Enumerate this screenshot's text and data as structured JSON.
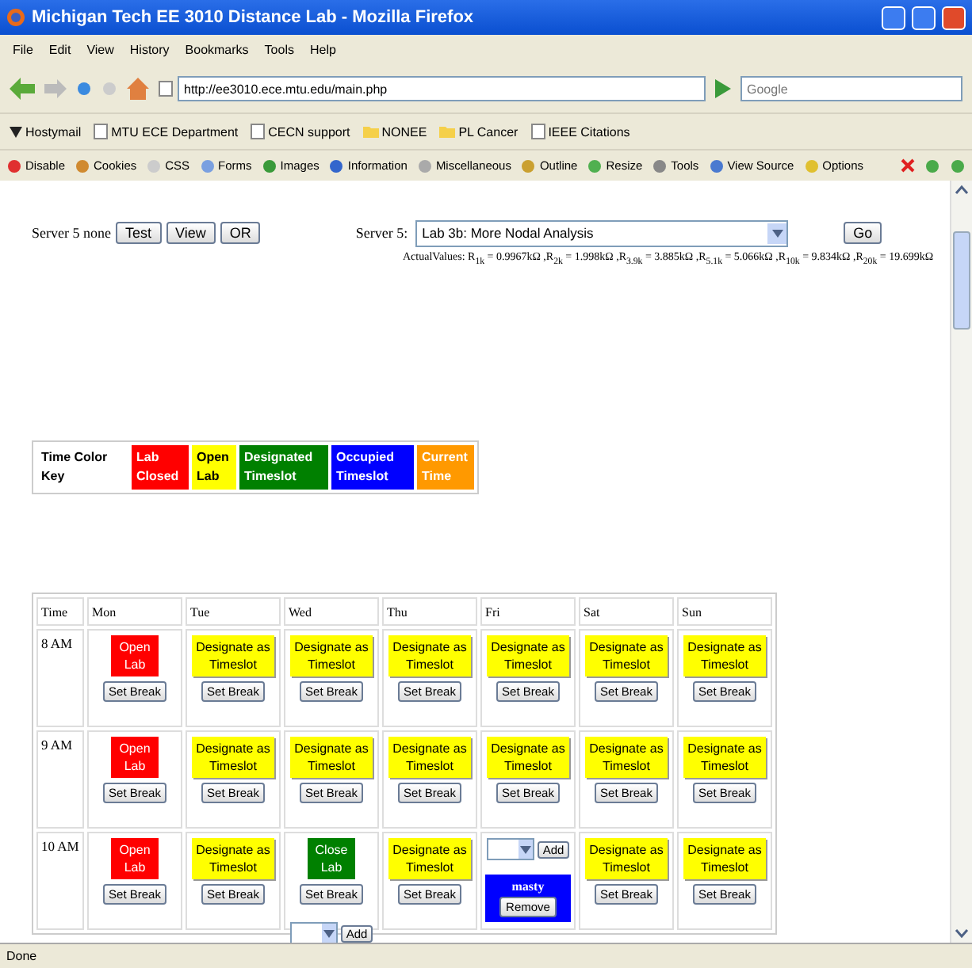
{
  "window": {
    "title": "Michigan Tech EE 3010 Distance Lab - Mozilla Firefox"
  },
  "menu": [
    "File",
    "Edit",
    "View",
    "History",
    "Bookmarks",
    "Tools",
    "Help"
  ],
  "address": {
    "value": "http://ee3010.ece.mtu.edu/main.php"
  },
  "search": {
    "placeholder": "Google"
  },
  "bookmarks": [
    {
      "label": "Hostymail",
      "kind": "feed"
    },
    {
      "label": "MTU ECE Department",
      "kind": "page"
    },
    {
      "label": "CECN support",
      "kind": "page"
    },
    {
      "label": "NONEE",
      "kind": "folder"
    },
    {
      "label": "PL Cancer",
      "kind": "folder"
    },
    {
      "label": "IEEE Citations",
      "kind": "page"
    }
  ],
  "dev_toolbar": [
    "Disable",
    "Cookies",
    "CSS",
    "Forms",
    "Images",
    "Information",
    "Miscellaneous",
    "Outline",
    "Resize",
    "Tools",
    "View Source",
    "Options"
  ],
  "server_row": {
    "label": "Server 5 none",
    "buttons": [
      "Test",
      "View",
      "OR"
    ],
    "select_label": "Server 5:",
    "select_value": "Lab 3b: More Nodal Analysis",
    "go": "Go"
  },
  "actual_values": "ActualValues: R$_{1k}$ = 0.9967kΩ ,R$_{2k}$ = 1.998kΩ ,R$_{3.9k}$ = 3.885kΩ ,R$_{5.1k}$ = 5.066kΩ ,R$_{10k}$ = 9.834kΩ ,R$_{20k}$ = 19.699kΩ",
  "color_key": [
    {
      "label": "Time Color Key",
      "color": "#ffffff"
    },
    {
      "label": "Lab Closed",
      "color": "#ff0000"
    },
    {
      "label": "Open Lab",
      "color": "#ffff00"
    },
    {
      "label": "Designated Timeslot",
      "color": "#008000"
    },
    {
      "label": "Occupied Timeslot",
      "color": "#0000ff"
    },
    {
      "label": "Current Time",
      "color": "#ff9900"
    }
  ],
  "schedule": {
    "columns": [
      "Time",
      "Mon",
      "Tue",
      "Wed",
      "Thu",
      "Fri",
      "Sat",
      "Sun"
    ],
    "rows": [
      {
        "cells": [
          {
            "kind": "time",
            "text": "8 AM"
          },
          {
            "kind": "open",
            "label": "Open Lab",
            "break": "Set Break"
          },
          {
            "kind": "designate",
            "label": "Designate as Timeslot",
            "break": "Set Break"
          },
          {
            "kind": "designate",
            "label": "Designate as Timeslot",
            "break": "Set Break"
          },
          {
            "kind": "designate",
            "label": "Designate as Timeslot",
            "break": "Set Break"
          },
          {
            "kind": "designate",
            "label": "Designate as Timeslot",
            "break": "Set Break"
          },
          {
            "kind": "designate",
            "label": "Designate as Timeslot",
            "break": "Set Break"
          },
          {
            "kind": "designate",
            "label": "Designate as Timeslot",
            "break": "Set Break"
          }
        ]
      },
      {
        "cells": [
          {
            "kind": "time",
            "text": "9 AM"
          },
          {
            "kind": "open",
            "label": "Open Lab",
            "break": "Set Break"
          },
          {
            "kind": "designate",
            "label": "Designate as Timeslot",
            "break": "Set Break"
          },
          {
            "kind": "designate",
            "label": "Designate as Timeslot",
            "break": "Set Break"
          },
          {
            "kind": "designate",
            "label": "Designate as Timeslot",
            "break": "Set Break"
          },
          {
            "kind": "designate",
            "label": "Designate as Timeslot",
            "break": "Set Break"
          },
          {
            "kind": "designate",
            "label": "Designate as Timeslot",
            "break": "Set Break"
          },
          {
            "kind": "designate",
            "label": "Designate as Timeslot",
            "break": "Set Break"
          }
        ]
      },
      {
        "cells": [
          {
            "kind": "time",
            "text": "10 AM"
          },
          {
            "kind": "open",
            "label": "Open Lab",
            "break": "Set Break"
          },
          {
            "kind": "designate",
            "label": "Designate as Timeslot",
            "break": "Set Break"
          },
          {
            "kind": "close",
            "label": "Close Lab",
            "break": "Set Break",
            "add": "Add"
          },
          {
            "kind": "designate",
            "label": "Designate as Timeslot",
            "break": "Set Break"
          },
          {
            "kind": "occupied",
            "add": "Add",
            "user": "masty",
            "remove": "Remove"
          },
          {
            "kind": "designate",
            "label": "Designate as Timeslot",
            "break": "Set Break"
          },
          {
            "kind": "designate",
            "label": "Designate as Timeslot",
            "break": "Set Break"
          }
        ]
      }
    ]
  },
  "status_bar": "Done"
}
